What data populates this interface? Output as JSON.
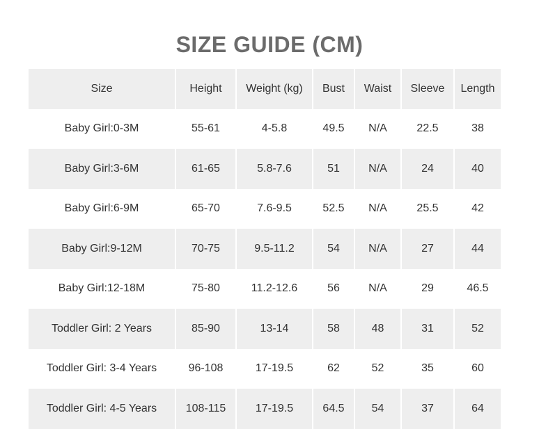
{
  "title": "SIZE GUIDE (CM)",
  "table": {
    "headers": [
      "Size",
      "Height",
      "Weight (kg)",
      "Bust",
      "Waist",
      "Sleeve",
      "Length"
    ],
    "rows": [
      [
        "Baby Girl:0-3M",
        "55-61",
        "4-5.8",
        "49.5",
        "N/A",
        "22.5",
        "38"
      ],
      [
        "Baby Girl:3-6M",
        "61-65",
        "5.8-7.6",
        "51",
        "N/A",
        "24",
        "40"
      ],
      [
        "Baby Girl:6-9M",
        "65-70",
        "7.6-9.5",
        "52.5",
        "N/A",
        "25.5",
        "42"
      ],
      [
        "Baby Girl:9-12M",
        "70-75",
        "9.5-11.2",
        "54",
        "N/A",
        "27",
        "44"
      ],
      [
        "Baby Girl:12-18M",
        "75-80",
        "11.2-12.6",
        "56",
        "N/A",
        "29",
        "46.5"
      ],
      [
        "Toddler Girl: 2 Years",
        "85-90",
        "13-14",
        "58",
        "48",
        "31",
        "52"
      ],
      [
        "Toddler Girl: 3-4 Years",
        "96-108",
        "17-19.5",
        "62",
        "52",
        "35",
        "60"
      ],
      [
        "Toddler Girl: 4-5 Years",
        "108-115",
        "17-19.5",
        "64.5",
        "54",
        "37",
        "64"
      ]
    ]
  },
  "colors": {
    "title": "#6b6b6b",
    "band": "#eeeeee",
    "text": "#333333"
  }
}
